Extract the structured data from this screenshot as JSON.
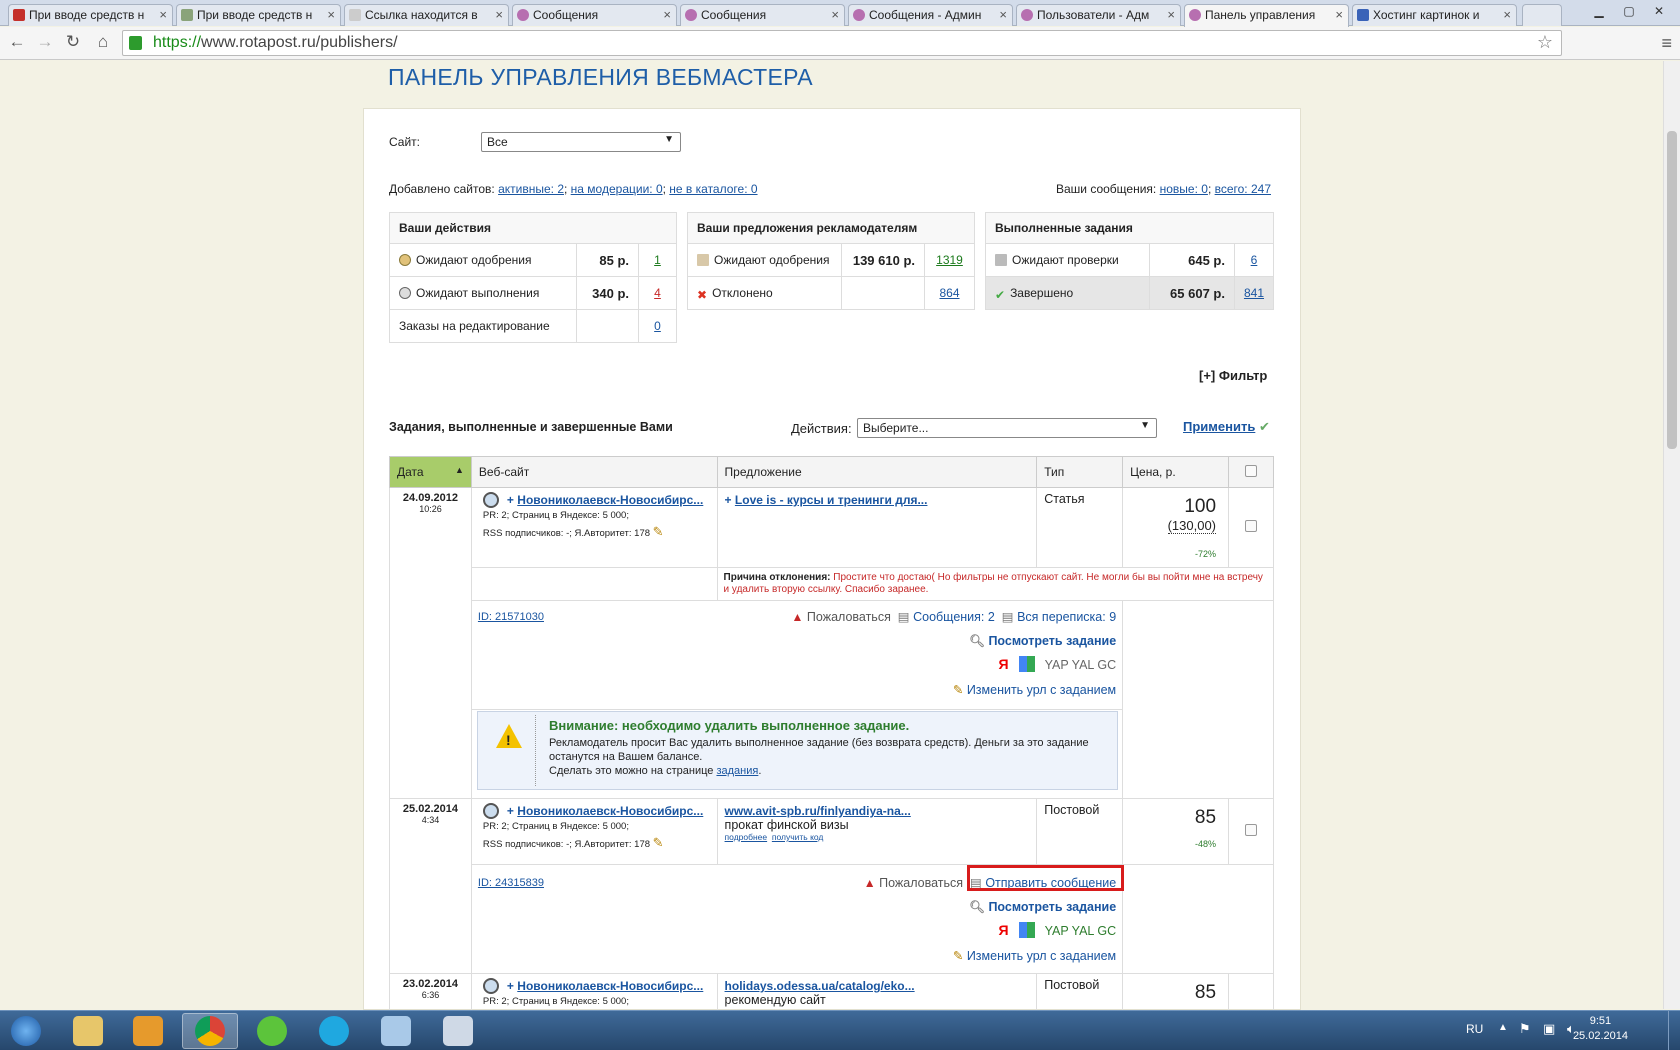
{
  "browser": {
    "tabs": [
      {
        "label": "При вводе средств н",
        "color": "#c4302b"
      },
      {
        "label": "При вводе средств н",
        "color": "#8aa37a"
      },
      {
        "label": "Ссылка находится в",
        "color": "#cccccc"
      },
      {
        "label": "Сообщения",
        "color": "#b76fb0"
      },
      {
        "label": "Сообщения",
        "color": "#b76fb0"
      },
      {
        "label": "Сообщения - Админ",
        "color": "#b76fb0"
      },
      {
        "label": "Пользователи - Адм",
        "color": "#b76fb0"
      },
      {
        "label": "Панель управления",
        "color": "#b76fb0"
      },
      {
        "label": "Хостинг картинок и",
        "color": "#3a63b8"
      }
    ],
    "url_secure": "https://",
    "url_rest": "www.rotapost.ru/publishers/"
  },
  "page": {
    "title": "ПАНЕЛЬ УПРАВЛЕНИЯ ВЕБМАСТЕРА",
    "site_label": "Сайт:",
    "site_value": "Все",
    "added_sites": {
      "prefix": "Добавлено сайтов:",
      "active": "активные: 2",
      "moderation": "на модерации: 0",
      "not_catalog": "не в каталоге: 0"
    },
    "messages": {
      "prefix": "Ваши сообщения:",
      "new": "новые: 0",
      "total": "всего: 247"
    },
    "your_actions": {
      "header": "Ваши действия",
      "rows": [
        {
          "label": "Ожидают одобрения",
          "value": "85 р.",
          "count": "1"
        },
        {
          "label": "Ожидают выполнения",
          "value": "340 р.",
          "count": "4"
        },
        {
          "label": "Заказы на редактирование",
          "value": "",
          "count": "0"
        }
      ]
    },
    "offers": {
      "header": "Ваши предложения рекламодателям",
      "rows": [
        {
          "label": "Ожидают одобрения",
          "value": "139 610 р.",
          "count": "1319"
        },
        {
          "label": "Отклонено",
          "value": "",
          "count": "864"
        }
      ]
    },
    "completed": {
      "header": "Выполненные задания",
      "rows": [
        {
          "label": "Ожидают проверки",
          "value": "645 р.",
          "count": "6"
        },
        {
          "label": "Завершено",
          "value": "65 607 р.",
          "count": "841"
        }
      ]
    },
    "filter": "[+] Фильтр",
    "tasks_title": "Задания, выполненные и завершенные Вами",
    "actions_label": "Действия:",
    "actions_value": "Выберите...",
    "apply": "Применить",
    "columns": [
      "Дата",
      "Веб-сайт",
      "Предложение",
      "Тип",
      "Цена, р."
    ],
    "tasks": [
      {
        "date": "24.09.2012",
        "time": "10:26",
        "site": "Новониколаевск-Новосибирс...",
        "pr": "PR: 2; Страниц в Яндексе: 5 000;",
        "rss": "RSS подписчиков: -; Я.Авторитет: 178",
        "offer": "Love is - курсы и тренинги для...",
        "type": "Статья",
        "price": "100",
        "price_orig": "(130,00)",
        "pct": "-72%",
        "reason_label": "Причина отклонения:",
        "reason": "Простите что достаю( Но фильтры не отпускают сайт. Не могли бы вы пойти мне на встречу и удалить вторую ссылку. Спасибо заранее.",
        "id": "ID: 21571030",
        "complain": "Пожаловаться",
        "msgs": "Сообщения: 2",
        "correspondence": "Вся переписка: 9",
        "view": "Посмотреть задание",
        "engines": "YAP YAL GC",
        "change": "Изменить урл с заданием"
      },
      {
        "date": "25.02.2014",
        "time": "4:34",
        "site": "Новониколаевск-Новосибирс...",
        "pr": "PR: 2; Страниц в Яндексе: 5 000;",
        "rss": "RSS подписчиков: -; Я.Авторитет: 178",
        "offer": "www.avit-spb.ru/finlyandiya-na...",
        "offer_text": "прокат финской визы",
        "more": "подробнее",
        "get_code": "получить код",
        "type": "Постовой",
        "price": "85",
        "pct": "-48%",
        "id": "ID: 24315839",
        "complain": "Пожаловаться",
        "send": "Отправить сообщение",
        "view": "Посмотреть задание",
        "engines": "YAP YAL GC",
        "change": "Изменить урл с заданием"
      },
      {
        "date": "23.02.2014",
        "time": "6:36",
        "site": "Новониколаевск-Новосибирс...",
        "pr": "PR: 2; Страниц в Яндексе: 5 000;",
        "offer": "holidays.odessa.ua/catalog/eko...",
        "offer_text": "рекомендую сайт",
        "type": "Постовой",
        "price": "85"
      }
    ],
    "warning": {
      "title": "Внимание: необходимо удалить выполненное задание.",
      "text1": "Рекламодатель просит Вас удалить выполненное задание (без возврата средств). Деньги за это задание останутся на Вашем балансе.",
      "text2": "Сделать это можно на странице",
      "link": "задания"
    }
  },
  "taskbar": {
    "lang": "RU",
    "time": "9:51",
    "date": "25.02.2014"
  }
}
